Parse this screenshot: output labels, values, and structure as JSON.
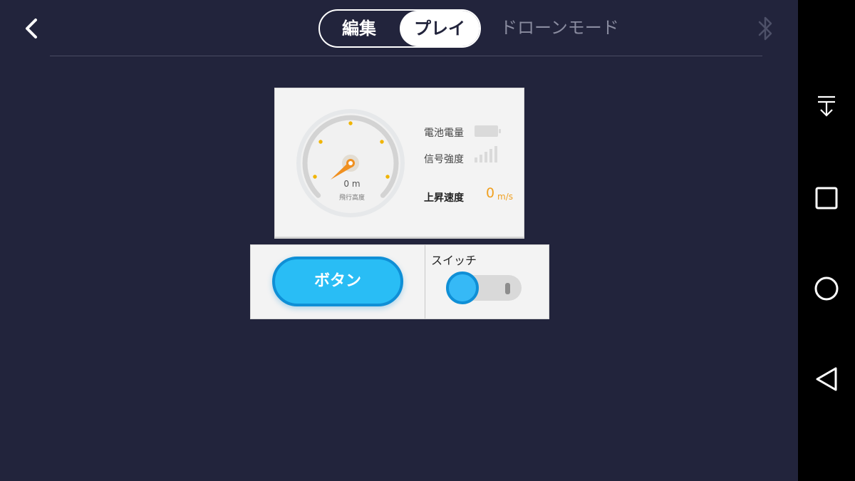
{
  "header": {
    "mode_edit_label": "編集",
    "mode_play_label": "プレイ",
    "drone_mode_label": "ドローンモード",
    "active_mode": "プレイ",
    "icons": {
      "back": "chevron-left-icon",
      "bluetooth": "bluetooth-icon"
    }
  },
  "flight_card": {
    "altitude_value": "0 m",
    "altitude_label": "飛行高度",
    "battery_label": "電池電量",
    "signal_label": "信号強度",
    "climb_label": "上昇速度",
    "climb_value": "0",
    "climb_unit": "m/s",
    "battery_level": 0,
    "signal_bars": 0,
    "colors": {
      "accent": "#f0a020",
      "gauge_ring": "#d6d6d6"
    }
  },
  "controls": {
    "button_label": "ボタン",
    "switch_label": "スイッチ",
    "switch_on": false,
    "colors": {
      "button_fill": "#29bdf5",
      "button_border": "#0f8fd6"
    }
  },
  "system_nav": {
    "icons": [
      "notification-dropdown-icon",
      "recents-square-icon",
      "home-circle-icon",
      "back-triangle-icon"
    ]
  },
  "theme": {
    "background": "#22243c",
    "navbar": "#000000"
  }
}
